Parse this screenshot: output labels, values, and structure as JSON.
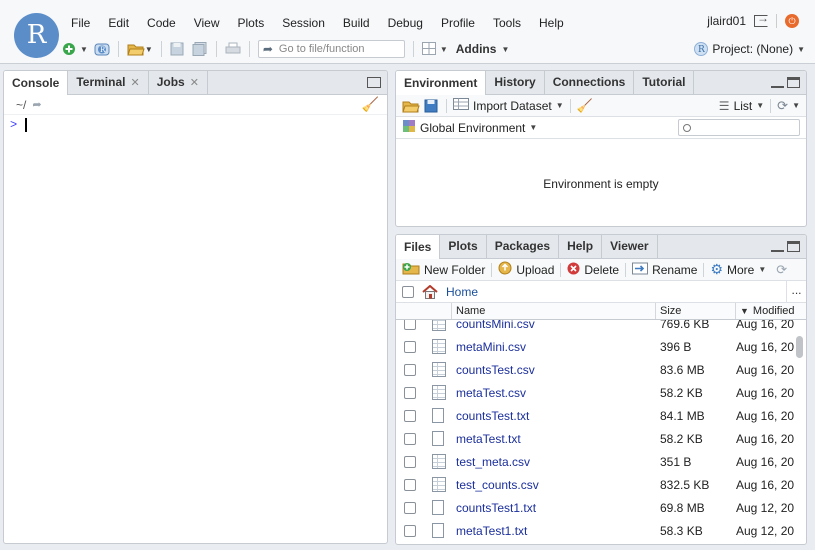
{
  "app": {
    "logo_letter": "R"
  },
  "menu": [
    "File",
    "Edit",
    "Code",
    "View",
    "Plots",
    "Session",
    "Build",
    "Debug",
    "Profile",
    "Tools",
    "Help"
  ],
  "user": {
    "name": "jlaird01"
  },
  "toolbar": {
    "goto_placeholder": "Go to file/function",
    "addins_label": "Addins",
    "project_label": "Project: (None)"
  },
  "console": {
    "tabs": [
      {
        "label": "Console",
        "closable": false
      },
      {
        "label": "Terminal",
        "closable": true
      },
      {
        "label": "Jobs",
        "closable": true
      }
    ],
    "path": "~/",
    "prompt": ">"
  },
  "environment": {
    "tabs": [
      "Environment",
      "History",
      "Connections",
      "Tutorial"
    ],
    "import_label": "Import Dataset",
    "list_label": "List",
    "scope_label": "Global Environment",
    "empty_message": "Environment is empty"
  },
  "files": {
    "tabs": [
      "Files",
      "Plots",
      "Packages",
      "Help",
      "Viewer"
    ],
    "actions": {
      "new_folder": "New Folder",
      "upload": "Upload",
      "delete": "Delete",
      "rename": "Rename",
      "more": "More"
    },
    "breadcrumb": "Home",
    "more_dots": "...",
    "columns": {
      "name": "Name",
      "size": "Size",
      "modified": "Modified"
    },
    "rows": [
      {
        "name": "countsMini.csv",
        "type": "csv",
        "size": "769.6 KB",
        "modified": "Aug 16, 20"
      },
      {
        "name": "metaMini.csv",
        "type": "csv",
        "size": "396 B",
        "modified": "Aug 16, 20"
      },
      {
        "name": "countsTest.csv",
        "type": "csv",
        "size": "83.6 MB",
        "modified": "Aug 16, 20"
      },
      {
        "name": "metaTest.csv",
        "type": "csv",
        "size": "58.2 KB",
        "modified": "Aug 16, 20"
      },
      {
        "name": "countsTest.txt",
        "type": "txt",
        "size": "84.1 MB",
        "modified": "Aug 16, 20"
      },
      {
        "name": "metaTest.txt",
        "type": "txt",
        "size": "58.2 KB",
        "modified": "Aug 16, 20"
      },
      {
        "name": "test_meta.csv",
        "type": "csv",
        "size": "351 B",
        "modified": "Aug 16, 20"
      },
      {
        "name": "test_counts.csv",
        "type": "csv",
        "size": "832.5 KB",
        "modified": "Aug 16, 20"
      },
      {
        "name": "countsTest1.txt",
        "type": "txt",
        "size": "69.8 MB",
        "modified": "Aug 12, 20"
      },
      {
        "name": "metaTest1.txt",
        "type": "txt",
        "size": "58.3 KB",
        "modified": "Aug 12, 20"
      }
    ]
  },
  "colors": {
    "accent": "#1b4f9c",
    "logo": "#5b8dc9",
    "power": "#e86a2c"
  }
}
